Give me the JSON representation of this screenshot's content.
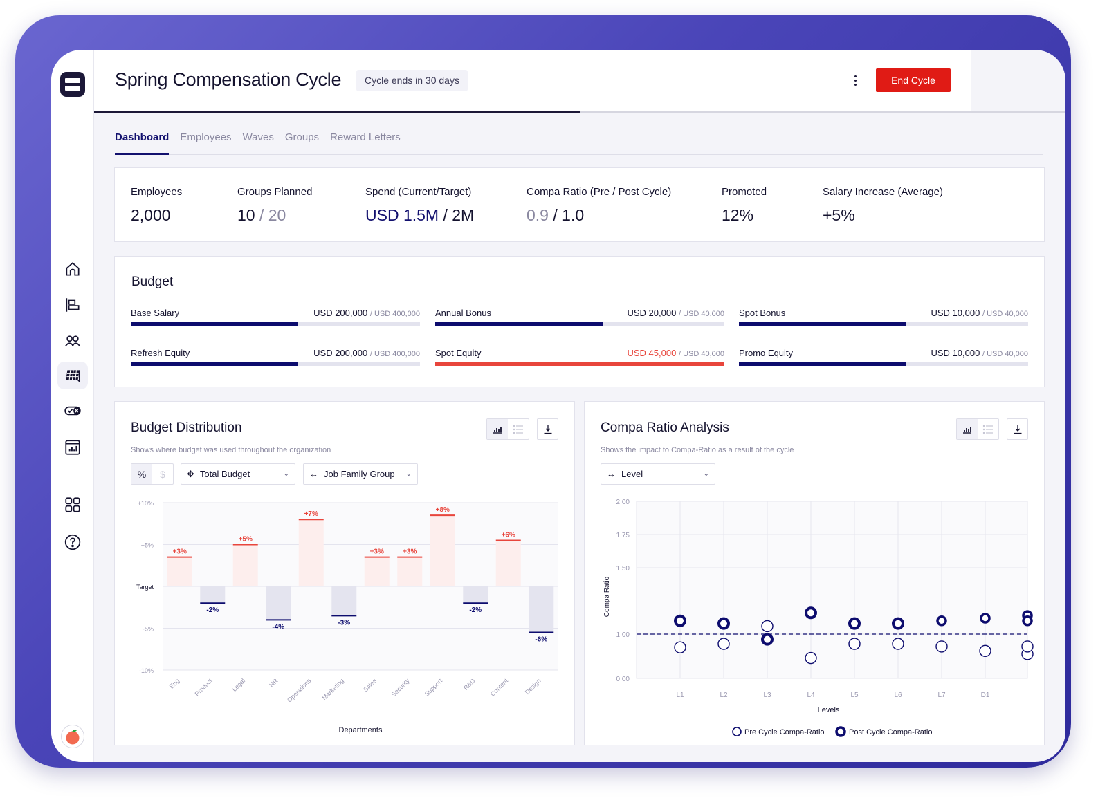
{
  "header": {
    "title": "Spring Compensation Cycle",
    "cycle_badge": "Cycle ends in 30 days",
    "end_cycle_label": "End Cycle",
    "cycle_progress": 0.5
  },
  "tabs": [
    {
      "label": "Dashboard",
      "active": true
    },
    {
      "label": "Employees",
      "active": false
    },
    {
      "label": "Waves",
      "active": false
    },
    {
      "label": "Groups",
      "active": false
    },
    {
      "label": "Reward Letters",
      "active": false
    }
  ],
  "sidebar": {
    "items": [
      {
        "icon": "home-icon"
      },
      {
        "icon": "align-left-bars-icon"
      },
      {
        "icon": "people-icon"
      },
      {
        "icon": "grid-calendar-icon",
        "active": true
      },
      {
        "icon": "toggle-check-icon"
      },
      {
        "icon": "report-chart-icon"
      },
      {
        "icon": "apps-grid-icon"
      },
      {
        "icon": "help-icon"
      }
    ],
    "avatar": "peach-avatar"
  },
  "stats": [
    {
      "label": "Employees",
      "value": "2,000",
      "secondary": ""
    },
    {
      "label": "Groups Planned",
      "value": "10",
      "secondary": "20"
    },
    {
      "label": "Spend (Current/Target)",
      "value": "USD 1.5M",
      "secondary": "2M"
    },
    {
      "label": "Compa Ratio (Pre / Post Cycle)",
      "value": "0.9",
      "secondary": "1.0"
    },
    {
      "label": "Promoted",
      "value": "12%",
      "secondary": ""
    },
    {
      "label": "Salary Increase (Average)",
      "value": "+5%",
      "secondary": ""
    }
  ],
  "budget": {
    "title": "Budget",
    "items": [
      {
        "label": "Base Salary",
        "current": "USD 200,000",
        "target": "USD 400,000",
        "fill": 0.58,
        "over": false
      },
      {
        "label": "Annual Bonus",
        "current": "USD 20,000",
        "target": "USD 40,000",
        "fill": 0.58,
        "over": false
      },
      {
        "label": "Spot Bonus",
        "current": "USD 10,000",
        "target": "USD 40,000",
        "fill": 0.58,
        "over": false
      },
      {
        "label": "Refresh Equity",
        "current": "USD 200,000",
        "target": "USD 400,000",
        "fill": 0.58,
        "over": false
      },
      {
        "label": "Spot Equity",
        "current": "USD 45,000",
        "target": "USD 40,000",
        "fill": 1.0,
        "over": true
      },
      {
        "label": "Promo Equity",
        "current": "USD 10,000",
        "target": "USD 40,000",
        "fill": 0.58,
        "over": false
      }
    ]
  },
  "budget_distribution": {
    "title": "Budget Distribution",
    "subtitle": "Shows where budget was used throughout the organization",
    "toggle": {
      "percent": "%",
      "dollar": "$"
    },
    "metric_select": "Total Budget",
    "group_select": "Job Family Group"
  },
  "compa_analysis": {
    "title": "Compa Ratio Analysis",
    "subtitle": "Shows the impact to Compa-Ratio as a result of the cycle",
    "group_select": "Level"
  },
  "colors": {
    "navy": "#0d0c6e",
    "red": "#e8453c",
    "end_cycle": "#e01b15"
  },
  "chart_data": [
    {
      "type": "bar",
      "title": "Budget Distribution",
      "xlabel": "Departments",
      "ylabel": "",
      "ylim": [
        -10,
        10
      ],
      "yticks": [
        {
          "value": 10,
          "label": "+10%"
        },
        {
          "value": 5,
          "label": "+5%"
        },
        {
          "value": 0,
          "label": "Target"
        },
        {
          "value": -5,
          "label": "-5%"
        },
        {
          "value": -10,
          "label": "-10%"
        }
      ],
      "categories": [
        "Eng",
        "Product",
        "Legal",
        "HR",
        "Operations",
        "Marketing",
        "Sales",
        "Security",
        "Support",
        "R&D",
        "Content",
        "Design"
      ],
      "values": [
        3.5,
        -2,
        5,
        -4,
        8,
        -3.5,
        3.5,
        3.5,
        8.5,
        -2,
        5.5,
        -5.5
      ],
      "labels": [
        "+3%",
        "-2%",
        "+5%",
        "-4%",
        "+7%",
        "-3%",
        "+3%",
        "+3%",
        "+8%",
        "-2%",
        "+6%",
        "-6%"
      ],
      "grid": true
    },
    {
      "type": "scatter",
      "title": "Compa Ratio Analysis",
      "xlabel": "Levels",
      "ylabel": "Compa Ratio",
      "yticks": [
        "0.00",
        "1.00",
        "1.50",
        "1.75",
        "2.00"
      ],
      "reference_line": 1.0,
      "categories": [
        "L1",
        "L2",
        "L3",
        "L4",
        "L5",
        "L6",
        "L7",
        "D1",
        "",
        ""
      ],
      "series": [
        {
          "name": "Pre Cycle Compa-Ratio",
          "values": [
            0.7,
            0.78,
            1.06,
            0.46,
            0.78,
            0.78,
            0.72,
            0.62,
            0.55,
            0.72
          ]
        },
        {
          "name": "Post Cycle Compa-Ratio",
          "values": [
            1.1,
            1.08,
            0.88,
            1.16,
            1.08,
            1.08,
            1.1,
            1.12,
            1.14,
            1.1
          ]
        }
      ],
      "legend": "bottom",
      "grid": true
    }
  ]
}
